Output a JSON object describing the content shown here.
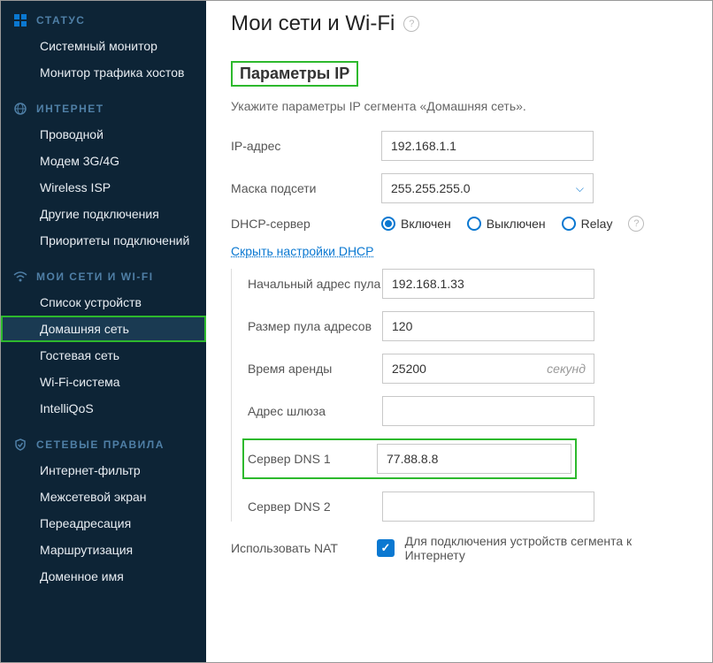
{
  "sidebar": {
    "sections": [
      {
        "title": "СТАТУС",
        "icon": "dashboard-icon",
        "items": [
          {
            "label": "Системный монитор"
          },
          {
            "label": "Монитор трафика хостов"
          }
        ]
      },
      {
        "title": "ИНТЕРНЕТ",
        "icon": "globe-icon",
        "items": [
          {
            "label": "Проводной"
          },
          {
            "label": "Модем 3G/4G"
          },
          {
            "label": "Wireless ISP"
          },
          {
            "label": "Другие подключения"
          },
          {
            "label": "Приоритеты подключений"
          }
        ]
      },
      {
        "title": "МОИ СЕТИ И WI-FI",
        "icon": "wifi-icon",
        "items": [
          {
            "label": "Список устройств"
          },
          {
            "label": "Домашняя сеть",
            "active": true,
            "highlighted": true
          },
          {
            "label": "Гостевая сеть"
          },
          {
            "label": "Wi-Fi-система"
          },
          {
            "label": "IntelliQoS"
          }
        ]
      },
      {
        "title": "СЕТЕВЫЕ ПРАВИЛА",
        "icon": "shield-icon",
        "items": [
          {
            "label": "Интернет-фильтр"
          },
          {
            "label": "Межсетевой экран"
          },
          {
            "label": "Переадресация"
          },
          {
            "label": "Маршрутизация"
          },
          {
            "label": "Доменное имя"
          }
        ]
      }
    ]
  },
  "page": {
    "title": "Мои сети и Wi-Fi",
    "section_title": "Параметры IP",
    "section_desc": "Укажите параметры IP сегмента «Домашняя сеть».",
    "labels": {
      "ip_address": "IP-адрес",
      "subnet_mask": "Маска подсети",
      "dhcp_server": "DHCP-сервер",
      "hide_dhcp": "Скрыть настройки DHCP",
      "pool_start": "Начальный адрес пула",
      "pool_size": "Размер пула адресов",
      "lease_time": "Время аренды",
      "lease_unit": "секунд",
      "gateway": "Адрес шлюза",
      "dns1": "Сервер DNS 1",
      "dns2": "Сервер DNS 2",
      "use_nat": "Использовать NAT",
      "nat_desc": "Для подключения устройств сегмента к Интернету"
    },
    "values": {
      "ip_address": "192.168.1.1",
      "subnet_mask": "255.255.255.0",
      "pool_start": "192.168.1.33",
      "pool_size": "120",
      "lease_time": "25200",
      "gateway": "",
      "dns1": "77.88.8.8",
      "dns2": ""
    },
    "dhcp_options": {
      "on": "Включен",
      "off": "Выключен",
      "relay": "Relay"
    }
  }
}
